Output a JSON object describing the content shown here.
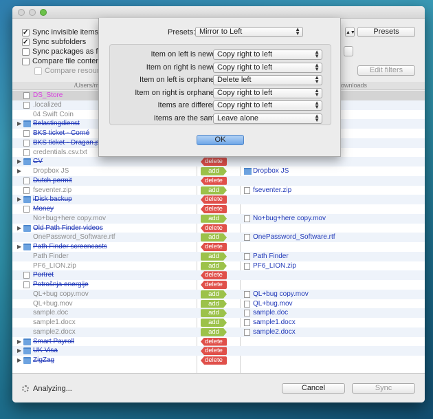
{
  "options": {
    "sync_invisible": "Sync invisible items",
    "sync_subfolders": "Sync subfolders",
    "sync_packages": "Sync packages as folde",
    "compare_contents": "Compare file contents",
    "compare_resource": "Compare resource",
    "presets_button": "Presets",
    "edit_filters_button": "Edit filters"
  },
  "path": {
    "left": "/Users/mi",
    "right": "ownloads"
  },
  "rows": [
    {
      "name": "DS_Store",
      "style": "pink",
      "icon": "file",
      "tri": false,
      "sel": true,
      "badge": "",
      "right": ""
    },
    {
      "name": ".localized",
      "style": "gray",
      "icon": "file",
      "tri": false,
      "badge": "",
      "right": ""
    },
    {
      "name": "04 Swift Coin",
      "style": "gray",
      "icon": "blank",
      "tri": false,
      "badge": "",
      "right": ""
    },
    {
      "name": "Belastingdienst",
      "style": "del",
      "icon": "folder",
      "tri": true,
      "badge": "",
      "right": ""
    },
    {
      "name": "BKS ticket - Corné",
      "style": "del",
      "icon": "file",
      "tri": false,
      "badge": "",
      "right": ""
    },
    {
      "name": "BKS ticket - Dragan.pdf",
      "style": "del",
      "icon": "file",
      "tri": false,
      "badge": "",
      "right": ""
    },
    {
      "name": "credentials.csv.txt",
      "style": "gray",
      "icon": "file",
      "tri": false,
      "badge": "",
      "right": ""
    },
    {
      "name": "CV",
      "style": "del",
      "icon": "folder",
      "tri": true,
      "badge": "delete",
      "right": ""
    },
    {
      "name": "Dropbox JS",
      "style": "gray",
      "icon": "blank",
      "tri": true,
      "badge": "add",
      "right": "Dropbox JS",
      "ricon": "folder"
    },
    {
      "name": "Dutch permit",
      "style": "del",
      "icon": "file",
      "tri": false,
      "badge": "delete",
      "right": ""
    },
    {
      "name": "fseventer.zip",
      "style": "gray",
      "icon": "file",
      "tri": false,
      "badge": "add",
      "right": "fseventer.zip",
      "ricon": "file"
    },
    {
      "name": "iDisk backup",
      "style": "del",
      "icon": "folder",
      "tri": true,
      "badge": "delete",
      "right": ""
    },
    {
      "name": "Money",
      "style": "del",
      "icon": "file",
      "tri": false,
      "badge": "delete",
      "right": ""
    },
    {
      "name": "No+bug+here copy.mov",
      "style": "gray",
      "icon": "blank",
      "tri": false,
      "badge": "add",
      "right": "No+bug+here copy.mov",
      "ricon": "file"
    },
    {
      "name": "Old Path Finder videos",
      "style": "del",
      "icon": "folder",
      "tri": true,
      "badge": "delete",
      "right": ""
    },
    {
      "name": "OnePassword_Software.rtf",
      "style": "gray",
      "icon": "blank",
      "tri": false,
      "badge": "add",
      "right": "OnePassword_Software.rtf",
      "ricon": "file"
    },
    {
      "name": "Path Finder screencasts",
      "style": "del",
      "icon": "folder",
      "tri": true,
      "badge": "delete",
      "right": ""
    },
    {
      "name": "Path Finder",
      "style": "gray",
      "icon": "blank",
      "tri": false,
      "badge": "add",
      "right": "Path Finder",
      "ricon": "file"
    },
    {
      "name": "PF6_LION.zip",
      "style": "gray",
      "icon": "blank",
      "tri": false,
      "badge": "add",
      "right": "PF6_LION.zip",
      "ricon": "file"
    },
    {
      "name": "Portret",
      "style": "del",
      "icon": "file",
      "tri": false,
      "badge": "delete",
      "right": ""
    },
    {
      "name": "Potrošnja energije",
      "style": "del",
      "icon": "file",
      "tri": false,
      "badge": "delete",
      "right": ""
    },
    {
      "name": "QL+bug copy.mov",
      "style": "gray",
      "icon": "blank",
      "tri": false,
      "badge": "add",
      "right": "QL+bug copy.mov",
      "ricon": "file"
    },
    {
      "name": "QL+bug.mov",
      "style": "gray",
      "icon": "blank",
      "tri": false,
      "badge": "add",
      "right": "QL+bug.mov",
      "ricon": "file"
    },
    {
      "name": "sample.doc",
      "style": "gray",
      "icon": "blank",
      "tri": false,
      "badge": "add",
      "right": "sample.doc",
      "ricon": "file"
    },
    {
      "name": "sample1.docx",
      "style": "gray",
      "icon": "blank",
      "tri": false,
      "badge": "add",
      "right": "sample1.docx",
      "ricon": "file"
    },
    {
      "name": "sample2.docx",
      "style": "gray",
      "icon": "blank",
      "tri": false,
      "badge": "add",
      "right": "sample2.docx",
      "ricon": "file"
    },
    {
      "name": "Smart Payroll",
      "style": "del",
      "icon": "folder",
      "tri": true,
      "badge": "delete",
      "right": ""
    },
    {
      "name": "UK Visa",
      "style": "del",
      "icon": "folder",
      "tri": true,
      "badge": "delete",
      "right": ""
    },
    {
      "name": "ZigZag",
      "style": "del",
      "icon": "folder",
      "tri": true,
      "badge": "delete",
      "right": ""
    }
  ],
  "bottom": {
    "status": "Analyzing...",
    "cancel": "Cancel",
    "sync": "Sync"
  },
  "sheet": {
    "presets_label": "Presets:",
    "presets_value": "Mirror to Left",
    "rules": [
      {
        "label": "Item on left is newer:",
        "value": "Copy right to left"
      },
      {
        "label": "Item on right is newer:",
        "value": "Copy right to left"
      },
      {
        "label": "Item on left is orphaned:",
        "value": "Delete left"
      },
      {
        "label": "Item on right is orphaned:",
        "value": "Copy right to left"
      },
      {
        "label": "Items are different:",
        "value": "Copy right to left"
      },
      {
        "label": "Items are the same:",
        "value": "Leave alone"
      }
    ],
    "ok": "OK"
  },
  "colors": {
    "delete_badge": "#e0504a",
    "add_badge": "#9cc24a",
    "deleted_text": "#2038b8",
    "ok_button": "#6ea6e8"
  }
}
